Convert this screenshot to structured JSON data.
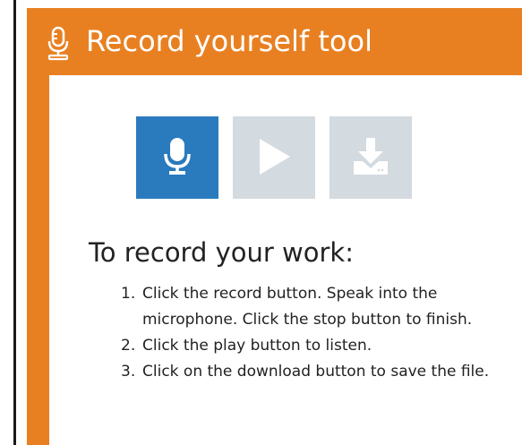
{
  "widget": {
    "title": "Record yourself tool",
    "header_icon": "microphone-icon",
    "colors": {
      "frame": "#e88022",
      "record_button": "#2a7bbd",
      "disabled_button": "#d3dae0"
    }
  },
  "controls": {
    "record": {
      "icon": "microphone-icon",
      "state": "enabled"
    },
    "play": {
      "icon": "play-icon",
      "state": "disabled"
    },
    "download": {
      "icon": "download-icon",
      "state": "disabled"
    }
  },
  "instructions": {
    "heading": "To record your work:",
    "steps": [
      {
        "number": "1.",
        "text": "Click the record button. Speak into the microphone. Click the stop button to finish."
      },
      {
        "number": "2.",
        "text": "Click the play button to listen."
      },
      {
        "number": "3.",
        "text": "Click on the download button to save the file."
      }
    ]
  }
}
